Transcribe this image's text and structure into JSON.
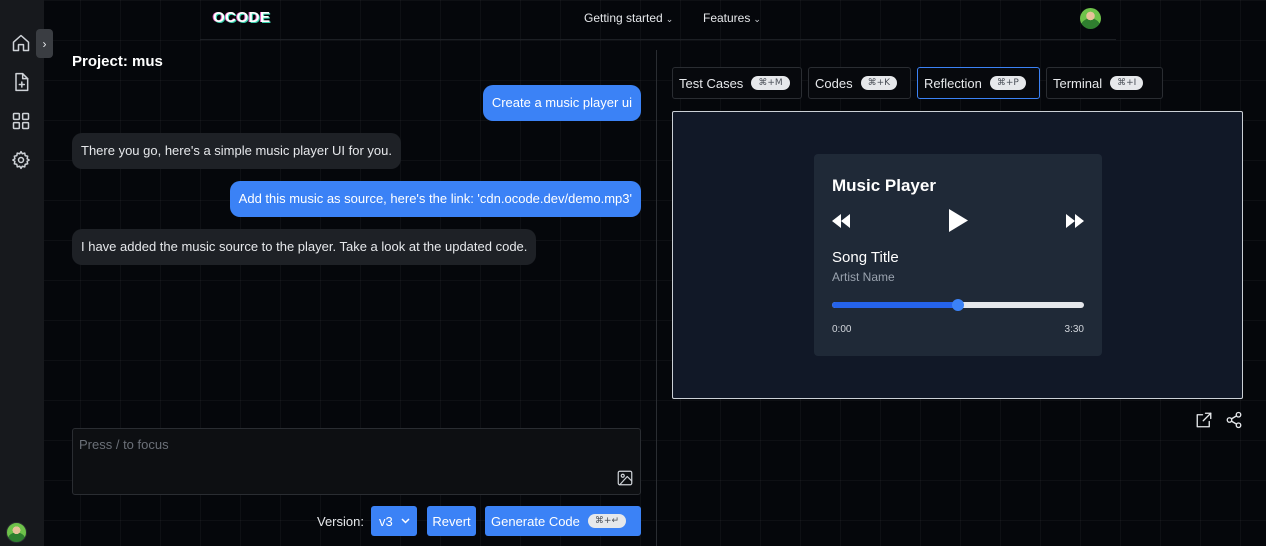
{
  "nav": {
    "logo": "OCODE",
    "links": [
      {
        "label": "Getting started",
        "chevron": "⌄"
      },
      {
        "label": "Features",
        "chevron": "⌄"
      }
    ]
  },
  "sidebar": {
    "toggle": "›",
    "items": [
      {
        "icon": "home-icon"
      },
      {
        "icon": "new-file-icon"
      },
      {
        "icon": "grid-icon"
      },
      {
        "icon": "settings-icon"
      }
    ]
  },
  "project": {
    "title": "Project: mus"
  },
  "chat": {
    "messages": [
      {
        "role": "user",
        "text": "Create a music player ui"
      },
      {
        "role": "assistant",
        "text": "There you go, here's a simple music player UI for you."
      },
      {
        "role": "user",
        "text": "Add this music as source, here's the link: 'cdn.ocode.dev/demo.mp3'"
      },
      {
        "role": "assistant",
        "text": "I have added the music source to the player. Take a look at the updated code."
      }
    ],
    "input_placeholder": "Press / to focus"
  },
  "controls": {
    "version_label": "Version:",
    "version_value": "v3",
    "revert_label": "Revert",
    "generate_label": "Generate Code",
    "generate_shortcut": "⌘+↵"
  },
  "tabs": [
    {
      "label": "Test Cases",
      "shortcut": "⌘+M"
    },
    {
      "label": "Codes",
      "shortcut": "⌘+K"
    },
    {
      "label": "Reflection",
      "shortcut": "⌘+P",
      "active": true
    },
    {
      "label": "Terminal",
      "shortcut": "⌘+I"
    }
  ],
  "player": {
    "title": "Music Player",
    "song_title": "Song Title",
    "artist": "Artist Name",
    "current_time": "0:00",
    "duration": "3:30",
    "progress": 0.5
  },
  "colors": {
    "accent": "#3b82f6",
    "background": "#05070b",
    "bubble_bot": "#1e2126",
    "player_card": "#1f2937"
  }
}
